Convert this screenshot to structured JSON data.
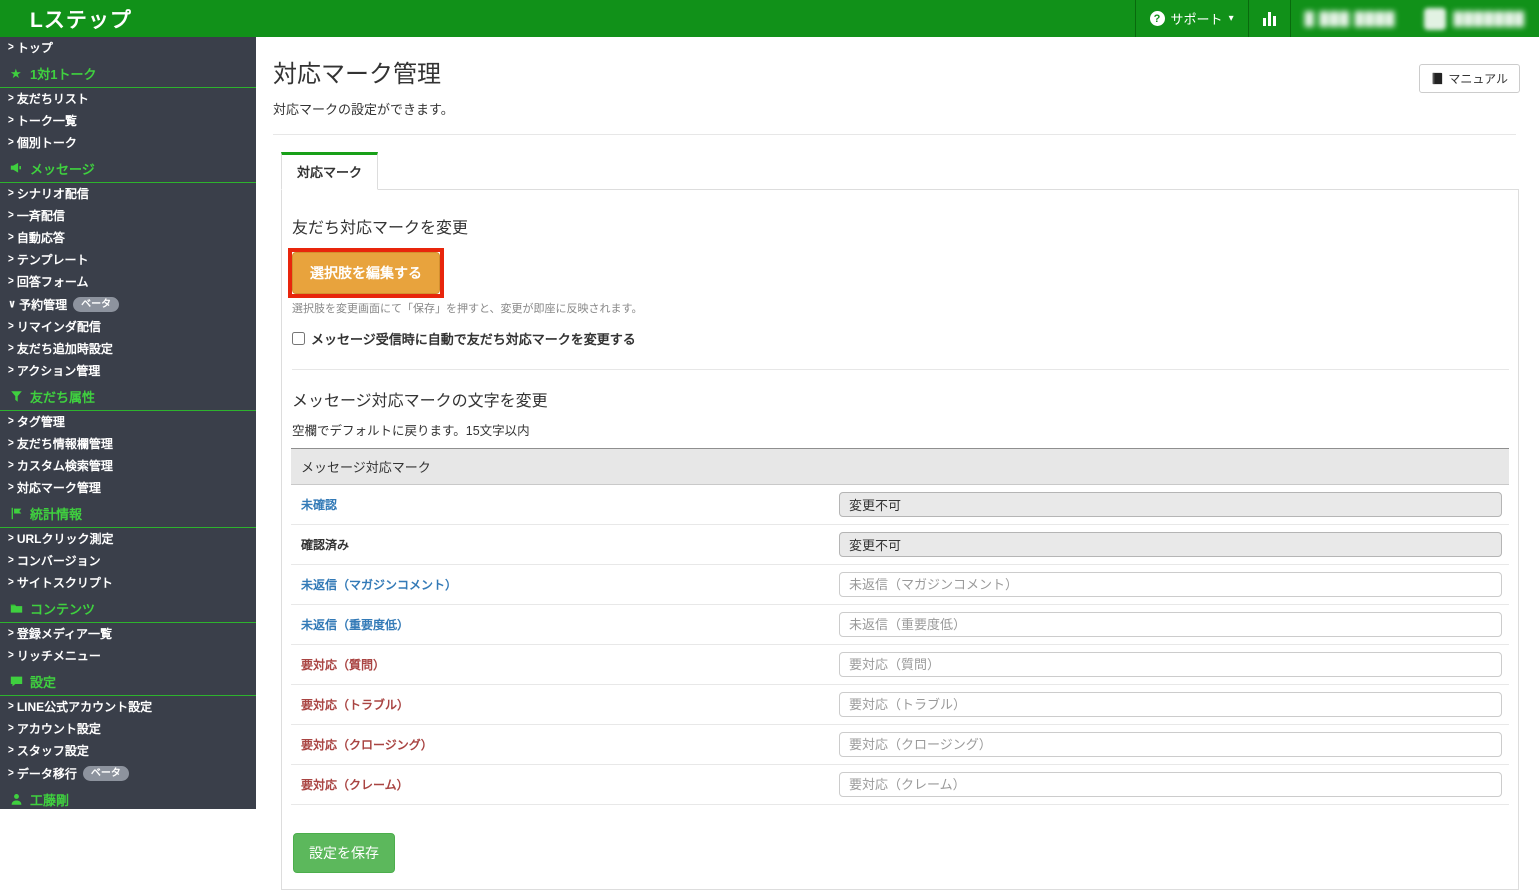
{
  "topbar": {
    "logo": "Lステップ",
    "support_label": "サポート",
    "question_glyph": "?",
    "caret_glyph": "▾",
    "icons": [
      "question-circle-icon",
      "caret-down-icon",
      "bar-chart-icon"
    ],
    "account_blurred": "█ ███ ████",
    "user_blurred": "███████"
  },
  "sidebar": {
    "entries": [
      {
        "type": "item",
        "label": "トップ"
      },
      {
        "type": "header",
        "label": "1対1トーク",
        "icon": "star-icon"
      },
      {
        "type": "item",
        "label": "友だちリスト"
      },
      {
        "type": "item",
        "label": "トーク一覧"
      },
      {
        "type": "item",
        "label": "個別トーク"
      },
      {
        "type": "header",
        "label": "メッセージ",
        "icon": "megaphone-icon"
      },
      {
        "type": "item",
        "label": "シナリオ配信"
      },
      {
        "type": "item",
        "label": "一斉配信"
      },
      {
        "type": "item",
        "label": "自動応答"
      },
      {
        "type": "item",
        "label": "テンプレート"
      },
      {
        "type": "item",
        "label": "回答フォーム"
      },
      {
        "type": "item",
        "label": "予約管理",
        "chevron": "down",
        "badge": "ベータ"
      },
      {
        "type": "item",
        "label": "リマインダ配信"
      },
      {
        "type": "item",
        "label": "友だち追加時設定"
      },
      {
        "type": "item",
        "label": "アクション管理"
      },
      {
        "type": "header",
        "label": "友だち属性",
        "icon": "funnel-icon"
      },
      {
        "type": "item",
        "label": "タグ管理"
      },
      {
        "type": "item",
        "label": "友だち情報欄管理"
      },
      {
        "type": "item",
        "label": "カスタム検索管理"
      },
      {
        "type": "item",
        "label": "対応マーク管理"
      },
      {
        "type": "header",
        "label": "統計情報",
        "icon": "flag-icon"
      },
      {
        "type": "item",
        "label": "URLクリック測定"
      },
      {
        "type": "item",
        "label": "コンバージョン"
      },
      {
        "type": "item",
        "label": "サイトスクリプト"
      },
      {
        "type": "header",
        "label": "コンテンツ",
        "icon": "folder-icon"
      },
      {
        "type": "item",
        "label": "登録メディア一覧"
      },
      {
        "type": "item",
        "label": "リッチメニュー"
      },
      {
        "type": "header",
        "label": "設定",
        "icon": "chat-icon"
      },
      {
        "type": "item",
        "label": "LINE公式アカウント設定"
      },
      {
        "type": "item",
        "label": "アカウント設定"
      },
      {
        "type": "item",
        "label": "スタッフ設定"
      },
      {
        "type": "item",
        "label": "データ移行",
        "badge": "ベータ"
      },
      {
        "type": "header",
        "label": "工藤剛",
        "icon": "person-icon"
      }
    ]
  },
  "page": {
    "title": "対応マーク管理",
    "subtitle": "対応マークの設定ができます。",
    "manual_button": "マニュアル",
    "manual_icon": "book-icon",
    "tab_label": "対応マーク"
  },
  "change_mark_section": {
    "heading": "友だち対応マークを変更",
    "edit_button": "選択肢を編集する",
    "edit_button_highlighted": true,
    "note": "選択肢を変更画面にて「保存」を押すと、変更が即座に反映されます。",
    "checkbox_label": "メッセージ受信時に自動で友だち対応マークを変更する",
    "checkbox_checked": false
  },
  "mark_text_section": {
    "heading": "メッセージ対応マークの文字を変更",
    "note": "空欄でデフォルトに戻ります。15文字以内",
    "table_header": "メッセージ対応マーク",
    "rows": [
      {
        "label": "未確認",
        "label_color": "blue",
        "disabled": true,
        "value": "変更不可",
        "placeholder": ""
      },
      {
        "label": "確認済み",
        "label_color": "dark",
        "disabled": true,
        "value": "変更不可",
        "placeholder": ""
      },
      {
        "label": "未返信（マガジンコメント）",
        "label_color": "blue",
        "disabled": false,
        "value": "",
        "placeholder": "未返信（マガジンコメント）"
      },
      {
        "label": "未返信（重要度低）",
        "label_color": "blue",
        "disabled": false,
        "value": "",
        "placeholder": "未返信（重要度低）"
      },
      {
        "label": "要対応（質問）",
        "label_color": "red",
        "disabled": false,
        "value": "",
        "placeholder": "要対応（質問）"
      },
      {
        "label": "要対応（トラブル）",
        "label_color": "red",
        "disabled": false,
        "value": "",
        "placeholder": "要対応（トラブル）"
      },
      {
        "label": "要対応（クロージング）",
        "label_color": "red",
        "disabled": false,
        "value": "",
        "placeholder": "要対応（クロージング）"
      },
      {
        "label": "要対応（クレーム）",
        "label_color": "red",
        "disabled": false,
        "value": "",
        "placeholder": "要対応（クレーム）"
      }
    ],
    "save_button": "設定を保存"
  },
  "colors": {
    "topbar_green": "#119119",
    "sidebar_bg": "#3a3f4a",
    "sidebar_accent_green": "#3fd03f",
    "tab_accent_green": "#18a018",
    "edit_button_orange": "#e8a33d",
    "highlight_red": "#e8250c",
    "save_button_green": "#5cb85c",
    "label_blue": "#337ab7",
    "label_red": "#a94442",
    "disabled_input_bg": "#e9e9e9"
  }
}
